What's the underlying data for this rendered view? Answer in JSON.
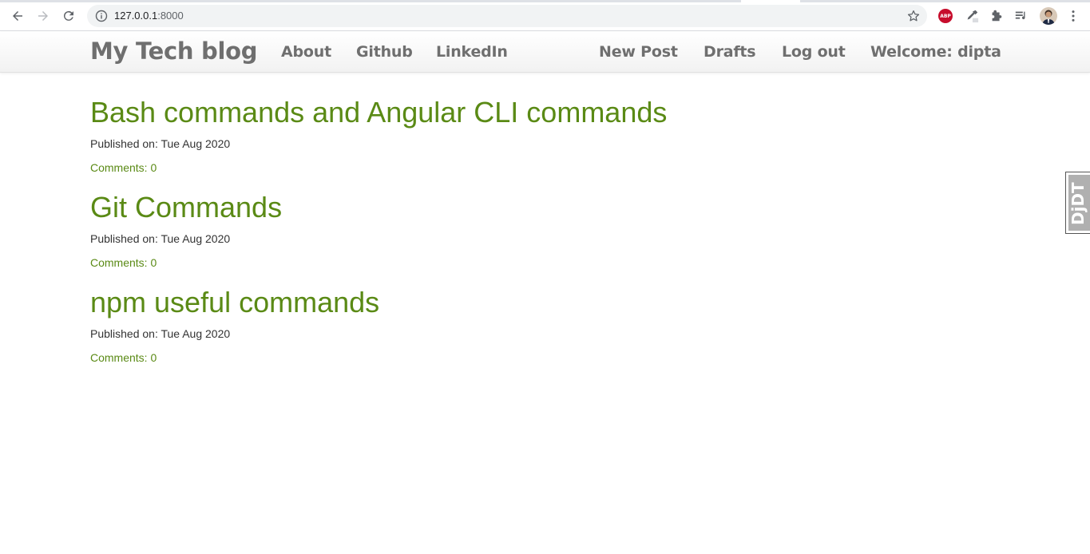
{
  "browser": {
    "url_host": "127.0.0.1",
    "url_port": ":8000",
    "extensions": [
      "adblock-plus-icon",
      "eyedropper-icon",
      "puzzle-extensions-icon",
      "reading-list-icon"
    ],
    "abp_label": "ABP"
  },
  "navbar": {
    "brand": "My Tech blog",
    "left_links": [
      "About",
      "Github",
      "LinkedIn"
    ],
    "right_links": [
      "New Post",
      "Drafts",
      "Log out",
      "Welcome: dipta"
    ]
  },
  "posts": [
    {
      "title": "Bash commands and Angular CLI commands",
      "published": "Published on: Tue Aug 2020",
      "comments": "Comments: 0"
    },
    {
      "title": "Git Commands",
      "published": "Published on: Tue Aug 2020",
      "comments": "Comments: 0"
    },
    {
      "title": "npm useful commands",
      "published": "Published on: Tue Aug 2020",
      "comments": "Comments: 0"
    }
  ],
  "debug_toolbar": {
    "label": "DjDT"
  },
  "colors": {
    "link_green": "#5a8a15",
    "nav_gray": "#6f6f6f"
  }
}
